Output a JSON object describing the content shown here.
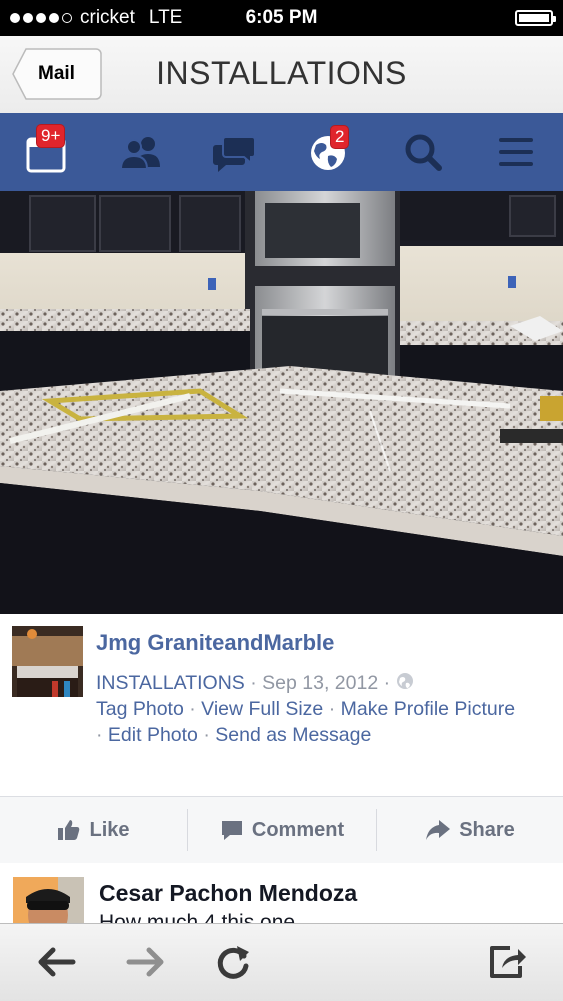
{
  "status_bar": {
    "carrier": "cricket",
    "network": "LTE",
    "time": "6:05 PM"
  },
  "nav": {
    "back_label": "Mail",
    "title": "INSTALLATIONS"
  },
  "fb_bar": {
    "icons": [
      "friend-requests-icon",
      "friends-icon",
      "messages-icon",
      "notifications-globe-icon",
      "search-icon",
      "menu-icon"
    ],
    "friend_requests_badge": "9+",
    "notifications_badge": "2",
    "brand_color": "#3b5998"
  },
  "post": {
    "poster_name": "Jmg GraniteandMarble",
    "album": "INSTALLATIONS",
    "date": "Sep 13, 2012",
    "links": {
      "tag_photo": "Tag Photo",
      "view_full_size": "View Full Size",
      "make_profile_picture": "Make Profile Picture",
      "edit_photo": "Edit Photo",
      "send_as_message": "Send as Message"
    }
  },
  "actions": {
    "like": "Like",
    "comment": "Comment",
    "share": "Share"
  },
  "comment": {
    "author": "Cesar Pachon Mendoza",
    "text": "How much 4 this one"
  },
  "toolbar": {
    "icons": [
      "back-arrow-icon",
      "forward-arrow-icon",
      "reload-icon",
      "share-icon"
    ]
  }
}
